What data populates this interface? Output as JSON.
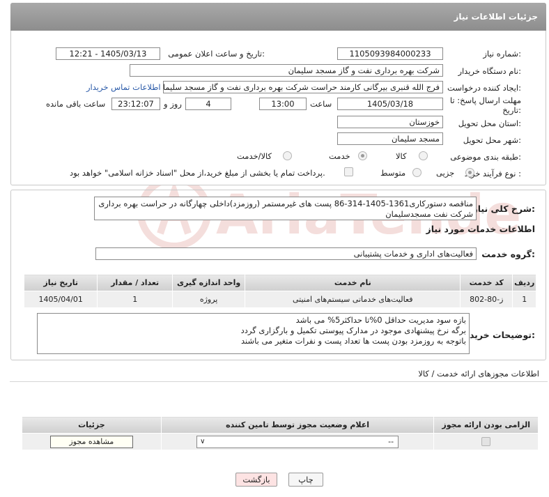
{
  "header": {
    "title": "جزئیات اطلاعات نیاز"
  },
  "form": {
    "need_number_label": "شماره نیاز:",
    "need_number": "1105093984000233",
    "announce_label": "تاریخ و ساعت اعلان عمومی:",
    "announce_value": "1405/03/13 - 12:21",
    "buyer_org_label": "نام دستگاه خریدار:",
    "buyer_org": "شرکت بهره برداری نفت و گاز مسجد سلیمان",
    "creator_label": "ایجاد کننده درخواست:",
    "creator": "فرج الله قنبری بیرگانی کارمند حراست شرکت بهره برداری نفت و گاز مسجد سلیمان",
    "contact_link": "اطلاعات تماس خریدار",
    "deadline_label_1": "مهلت ارسال پاسخ: تا",
    "deadline_label_2": "تاریخ:",
    "deadline_date": "1405/03/18",
    "time_label": "ساعت",
    "deadline_time": "13:00",
    "days_value": "4",
    "days_label": "روز و",
    "remaining_time": "23:12:07",
    "remaining_label": "ساعت باقی مانده",
    "province_label": "استان محل تحویل:",
    "province": "خوزستان",
    "city_label": "شهر محل تحویل:",
    "city": "مسجد سلیمان",
    "category_label": "طبقه بندی موضوعی:",
    "category_options": [
      "کالا",
      "خدمت",
      "کالا/خدمت"
    ],
    "category_selected": "خدمت",
    "process_label": "نوع فرآیند خرید :",
    "process_options": [
      "جزیی",
      "متوسط"
    ],
    "process_selected": "جزیی",
    "payment_note": "پرداخت تمام یا بخشی از مبلغ خرید،از محل \"اسناد خزانه اسلامی\" خواهد بود."
  },
  "summary": {
    "label": "شرح کلی نیاز:",
    "text": "مناقصه دستورکاری1361-1405-314-86 پست های غیرمستمر (روزمزد)داخلی چهارگانه  در حراست بهره برداری شرکت نفت مسجدسلیمان"
  },
  "services": {
    "section_title": "اطلاعات خدمات مورد نیاز",
    "group_label": "گروه خدمت:",
    "group_value": "فعالیت‌های اداری و خدمات پشتیبانی",
    "columns": [
      "ردیف",
      "کد خدمت",
      "نام خدمت",
      "واحد اندازه گیری",
      "تعداد / مقدار",
      "تاریخ نیاز"
    ],
    "rows": [
      {
        "row": "1",
        "code": "ز-80-802",
        "name": "فعالیت‌های خدماتی سیستم‌های امنیتی",
        "unit": "پروژه",
        "qty": "1",
        "date": "1405/04/01"
      }
    ]
  },
  "buyer_notes": {
    "label": "توضیحات خریدار:",
    "lines": [
      "بازه سود مدیریت حداقل 0%تا حداکثر5% می باشد",
      "برگه نرخ پیشنهادی موجود در مدارک پیوستی تکمیل و بارگزاری گردد",
      "باتوجه به روزمزد بودن پست ها تعداد پست و نفرات متغیر می باشند"
    ]
  },
  "permits": {
    "title": "اطلاعات مجوزهای ارائه خدمت / کالا",
    "columns": [
      "الزامی بودن ارائه مجوز",
      "اعلام وضعیت مجوز توسط تامین کننده",
      "جزئیات"
    ],
    "select_value": "--",
    "view_button": "مشاهده مجوز"
  },
  "footer": {
    "print_button": "چاپ",
    "back_button": "بازگشت"
  },
  "watermark": "AriaTender.neT",
  "colors": {
    "header_bg": "#9b9b9b",
    "link": "#2a5aa8",
    "back_button_bg": "#fde3e3",
    "watermark": "#c0392b"
  }
}
